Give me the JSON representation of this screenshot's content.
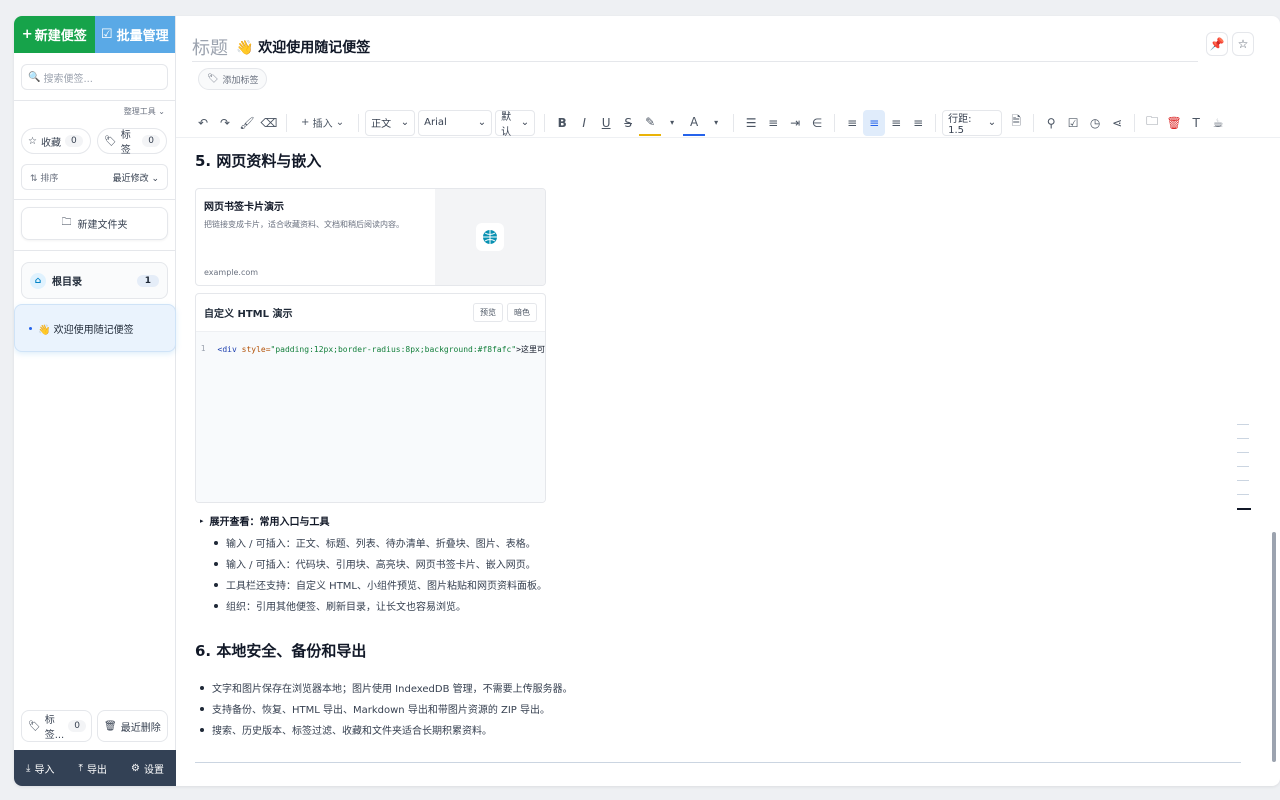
{
  "sidebar": {
    "new_note": "新建便签",
    "batch": "批量管理",
    "search_placeholder": "搜索便签...",
    "tools_label": "整理工具",
    "favorites": {
      "label": "收藏",
      "count": "0"
    },
    "tags": {
      "label": "标签",
      "count": "0"
    },
    "sort": {
      "label": "排序",
      "value": "最近修改"
    },
    "new_folder": "新建文件夹",
    "root": {
      "label": "根目录",
      "count": "1"
    },
    "note_item": "👋 欢迎使用随记便签",
    "bottom_tags": {
      "label": "标签...",
      "count": "0"
    },
    "recent_deleted": "最近删除",
    "footer": {
      "import": "导入",
      "export": "导出",
      "settings": "设置"
    }
  },
  "editor": {
    "title_label": "标题",
    "title_value": "👋 欢迎使用随记便签",
    "add_tag": "添加标签",
    "toolbar": {
      "insert": "插入",
      "block_type": "正文",
      "font": "Arial",
      "size": "默认",
      "line_height": "行距: 1.5"
    },
    "section5": "5. 网页资料与嵌入",
    "bookmark": {
      "title": "网页书签卡片演示",
      "desc": "把链接变成卡片，适合收藏资料、文档和稍后阅读内容。",
      "url": "example.com"
    },
    "html_block": {
      "title": "自定义 HTML 演示",
      "preview": "预览",
      "dark": "暗色",
      "line_no": "1",
      "code_tag": "<div ",
      "code_attr": "style=",
      "code_str": "\"padding:12px;border-radius:8px;background:#f8fafc\"",
      "code_end": ">这里可"
    },
    "details_summary": "展开查看：常用入口与工具",
    "details_items": [
      "输入 / 可插入：正文、标题、列表、待办清单、折叠块、图片、表格。",
      "输入 / 可插入：代码块、引用块、高亮块、网页书签卡片、嵌入网页。",
      "工具栏还支持：自定义 HTML、小组件预览、图片粘贴和网页资料面板。",
      "组织：引用其他便签、刷新目录，让长文也容易浏览。"
    ],
    "section6": "6. 本地安全、备份和导出",
    "section6_items": [
      "文字和图片保存在浏览器本地；图片使用 IndexedDB 管理，不需要上传服务器。",
      "支持备份、恢复、HTML 导出、Markdown 导出和带图片资源的 ZIP 导出。",
      "搜索、历史版本、标签过滤、收藏和文件夹适合长期积累资料。"
    ]
  },
  "colors": {
    "primary_green": "#16a34a",
    "batch_blue": "#5aa9e6",
    "footer_dark": "#334155",
    "active_note": "#eaf3fd"
  }
}
